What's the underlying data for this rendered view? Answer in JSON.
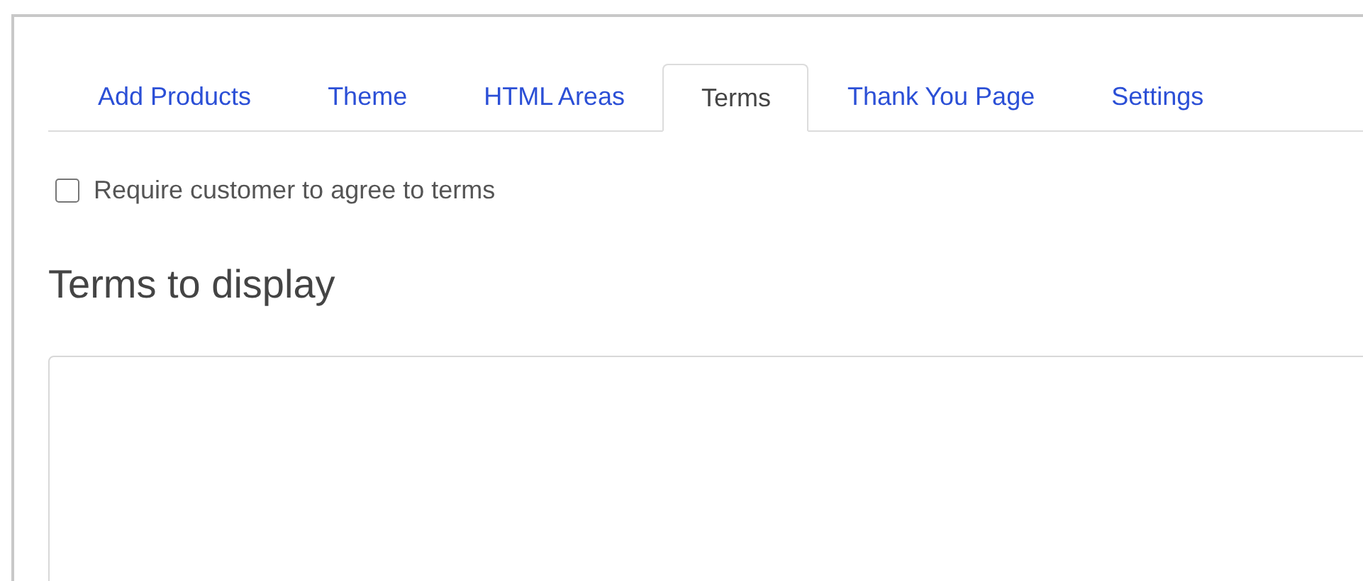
{
  "tabs": [
    {
      "label": "Add Products",
      "selected": false
    },
    {
      "label": "Theme",
      "selected": false
    },
    {
      "label": "HTML Areas",
      "selected": false
    },
    {
      "label": "Terms",
      "selected": true
    },
    {
      "label": "Thank You Page",
      "selected": false
    },
    {
      "label": "Settings",
      "selected": false
    }
  ],
  "require_terms": {
    "label": "Require customer to agree to terms",
    "checked": false
  },
  "terms_heading": "Terms to display"
}
